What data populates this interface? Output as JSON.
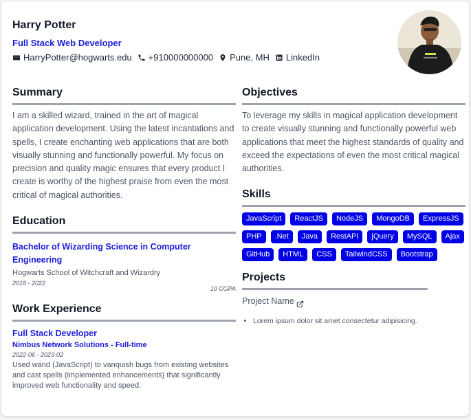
{
  "header": {
    "name": "Harry Potter",
    "role": "Full Stack Web Developer",
    "contacts": [
      {
        "icon": "mail-icon",
        "text": "HarryPotter@hogwarts.edu"
      },
      {
        "icon": "phone-icon",
        "text": "+910000000000"
      },
      {
        "icon": "location-pin-icon",
        "text": "Pune, MH"
      },
      {
        "icon": "linkedin-icon",
        "text": "LinkedIn"
      }
    ]
  },
  "summary": {
    "title": "Summary",
    "text": "I am a skilled wizard, trained in the art of magical application development. Using the latest incantations and spells, I create enchanting web applications that are both visually stunning and functionally powerful. My focus on precision and quality magic ensures that every product I create is worthy of the highest praise from even the most critical of magical authorities."
  },
  "education": {
    "title": "Education",
    "degree": "Bachelor of Wizarding Science in Computer Engineering",
    "school": "Hogwarts School of Witchcraft and Wizardry",
    "dates": "2018 - 2022",
    "gpa": "10 CGPA"
  },
  "work": {
    "title": "Work Experience",
    "job_title": "Full Stack Developer",
    "company": "Nimbus Network Solutions - Full-time",
    "dates": "2022-06 - 2023-02",
    "description": "Used wand (JavaScript) to vanquish bugs from existing websites and cast spells (implemented enhancements) that significantly improved web functionality and speed."
  },
  "objectives": {
    "title": "Objectives",
    "text": "To leverage my skills in magical application development to create visually stunning and functionally powerful web applications that meet the highest standards of quality and exceed the expectations of even the most critical magical authorities."
  },
  "skills": {
    "title": "Skills",
    "items": [
      "JavaScript",
      "ReactJS",
      "NodeJS",
      "MongoDB",
      "ExpressJS",
      "PHP",
      ".Net",
      "Java",
      "RestAPI",
      "jQuery",
      "MySQL",
      "Ajax",
      "GitHub",
      "HTML",
      "CSS",
      "TailwindCSS",
      "Bootstrap"
    ],
    "badge_color": "#0000e6"
  },
  "projects": {
    "title": "Projects",
    "name": "Project Name",
    "link_icon": "external-link-icon",
    "bullets": [
      "Lorem ipsum dolor sit amet consectetur adipisicing."
    ]
  },
  "colors": {
    "accent": "#1d1dd9",
    "divider": "#9ca3af"
  }
}
